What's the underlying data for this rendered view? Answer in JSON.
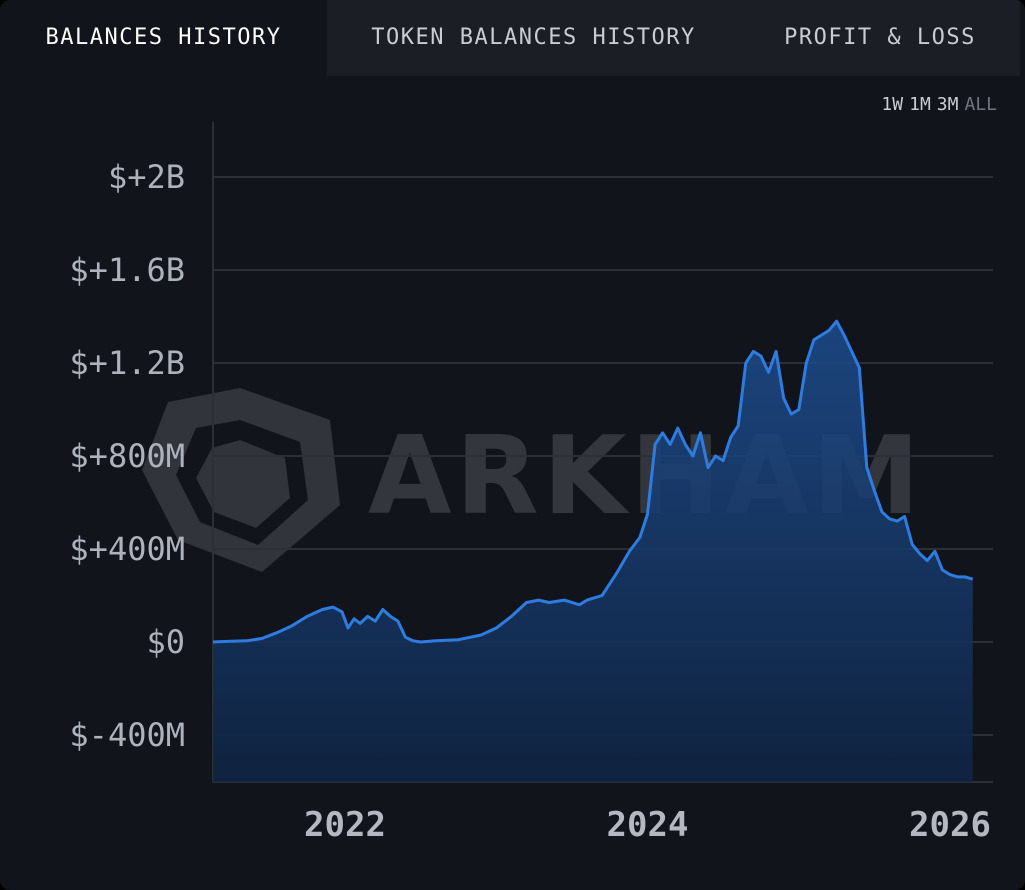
{
  "tabs": [
    {
      "label": "BALANCES HISTORY",
      "active": true
    },
    {
      "label": "TOKEN BALANCES HISTORY",
      "active": false
    },
    {
      "label": "PROFIT & LOSS",
      "active": false
    }
  ],
  "ranges": [
    {
      "label": "1W",
      "active": false
    },
    {
      "label": "1M",
      "active": false
    },
    {
      "label": "3M",
      "active": false
    },
    {
      "label": "ALL",
      "active": true
    }
  ],
  "watermark": "ARKHAM",
  "colors": {
    "line": "#2f7ce0",
    "fill": "#1a3a6e",
    "background": "#12141c",
    "grid": "#2c2f37"
  },
  "chart_data": {
    "type": "area",
    "title": "",
    "xlabel": "",
    "ylabel": "",
    "ylim": [
      -600000000,
      2200000000
    ],
    "xlim": [
      2021.0,
      2026.15
    ],
    "yticks": [
      {
        "value": 2000000000,
        "label": "$+2B"
      },
      {
        "value": 1600000000,
        "label": "$+1.6B"
      },
      {
        "value": 1200000000,
        "label": "$+1.2B"
      },
      {
        "value": 800000000,
        "label": "$+800M"
      },
      {
        "value": 400000000,
        "label": "$+400M"
      },
      {
        "value": 0,
        "label": "$0"
      },
      {
        "value": -400000000,
        "label": "$-400M"
      }
    ],
    "xticks": [
      {
        "value": 2022.0,
        "label": "2022"
      },
      {
        "value": 2024.0,
        "label": "2024"
      },
      {
        "value": 2026.0,
        "label": "2026"
      }
    ],
    "grid": true,
    "series": [
      {
        "x": [
          2021.0,
          2021.2,
          2021.35,
          2021.45,
          2021.55,
          2021.65,
          2021.75,
          2021.85,
          2021.92,
          2021.98,
          2022.02,
          2022.06,
          2022.1,
          2022.15,
          2022.2,
          2022.25,
          2022.3,
          2022.35,
          2022.4,
          2022.45,
          2022.5,
          2022.6,
          2022.75,
          2022.9,
          2023.0,
          2023.1,
          2023.2,
          2023.28,
          2023.35,
          2023.45,
          2023.55,
          2023.6,
          2023.7,
          2023.8,
          2023.88,
          2023.95,
          2024.0,
          2024.05,
          2024.1,
          2024.15,
          2024.2,
          2024.25,
          2024.3,
          2024.35,
          2024.4,
          2024.45,
          2024.5,
          2024.55,
          2024.6,
          2024.65,
          2024.7,
          2024.75,
          2024.8,
          2024.85,
          2024.9,
          2024.95,
          2025.0,
          2025.05,
          2025.1,
          2025.15,
          2025.2,
          2025.25,
          2025.3,
          2025.35,
          2025.4,
          2025.45,
          2025.5,
          2025.55,
          2025.6,
          2025.65,
          2025.7,
          2025.75,
          2025.8,
          2025.85,
          2025.9,
          2025.95,
          2026.0,
          2026.05,
          2026.1,
          2026.15
        ],
        "y": [
          0,
          2000000,
          5000000,
          15000000,
          40000000,
          70000000,
          110000000,
          140000000,
          150000000,
          130000000,
          60000000,
          100000000,
          80000000,
          110000000,
          90000000,
          140000000,
          110000000,
          90000000,
          20000000,
          5000000,
          0,
          5000000,
          10000000,
          30000000,
          60000000,
          110000000,
          170000000,
          180000000,
          170000000,
          180000000,
          160000000,
          180000000,
          200000000,
          300000000,
          390000000,
          450000000,
          550000000,
          850000000,
          900000000,
          850000000,
          920000000,
          850000000,
          800000000,
          900000000,
          750000000,
          800000000,
          780000000,
          880000000,
          930000000,
          1200000000,
          1250000000,
          1230000000,
          1160000000,
          1250000000,
          1050000000,
          980000000,
          1000000000,
          1200000000,
          1300000000,
          1320000000,
          1340000000,
          1380000000,
          1320000000,
          1250000000,
          1180000000,
          750000000,
          650000000,
          560000000,
          530000000,
          520000000,
          540000000,
          420000000,
          380000000,
          350000000,
          390000000,
          310000000,
          290000000,
          280000000,
          280000000,
          270000000
        ]
      }
    ]
  }
}
